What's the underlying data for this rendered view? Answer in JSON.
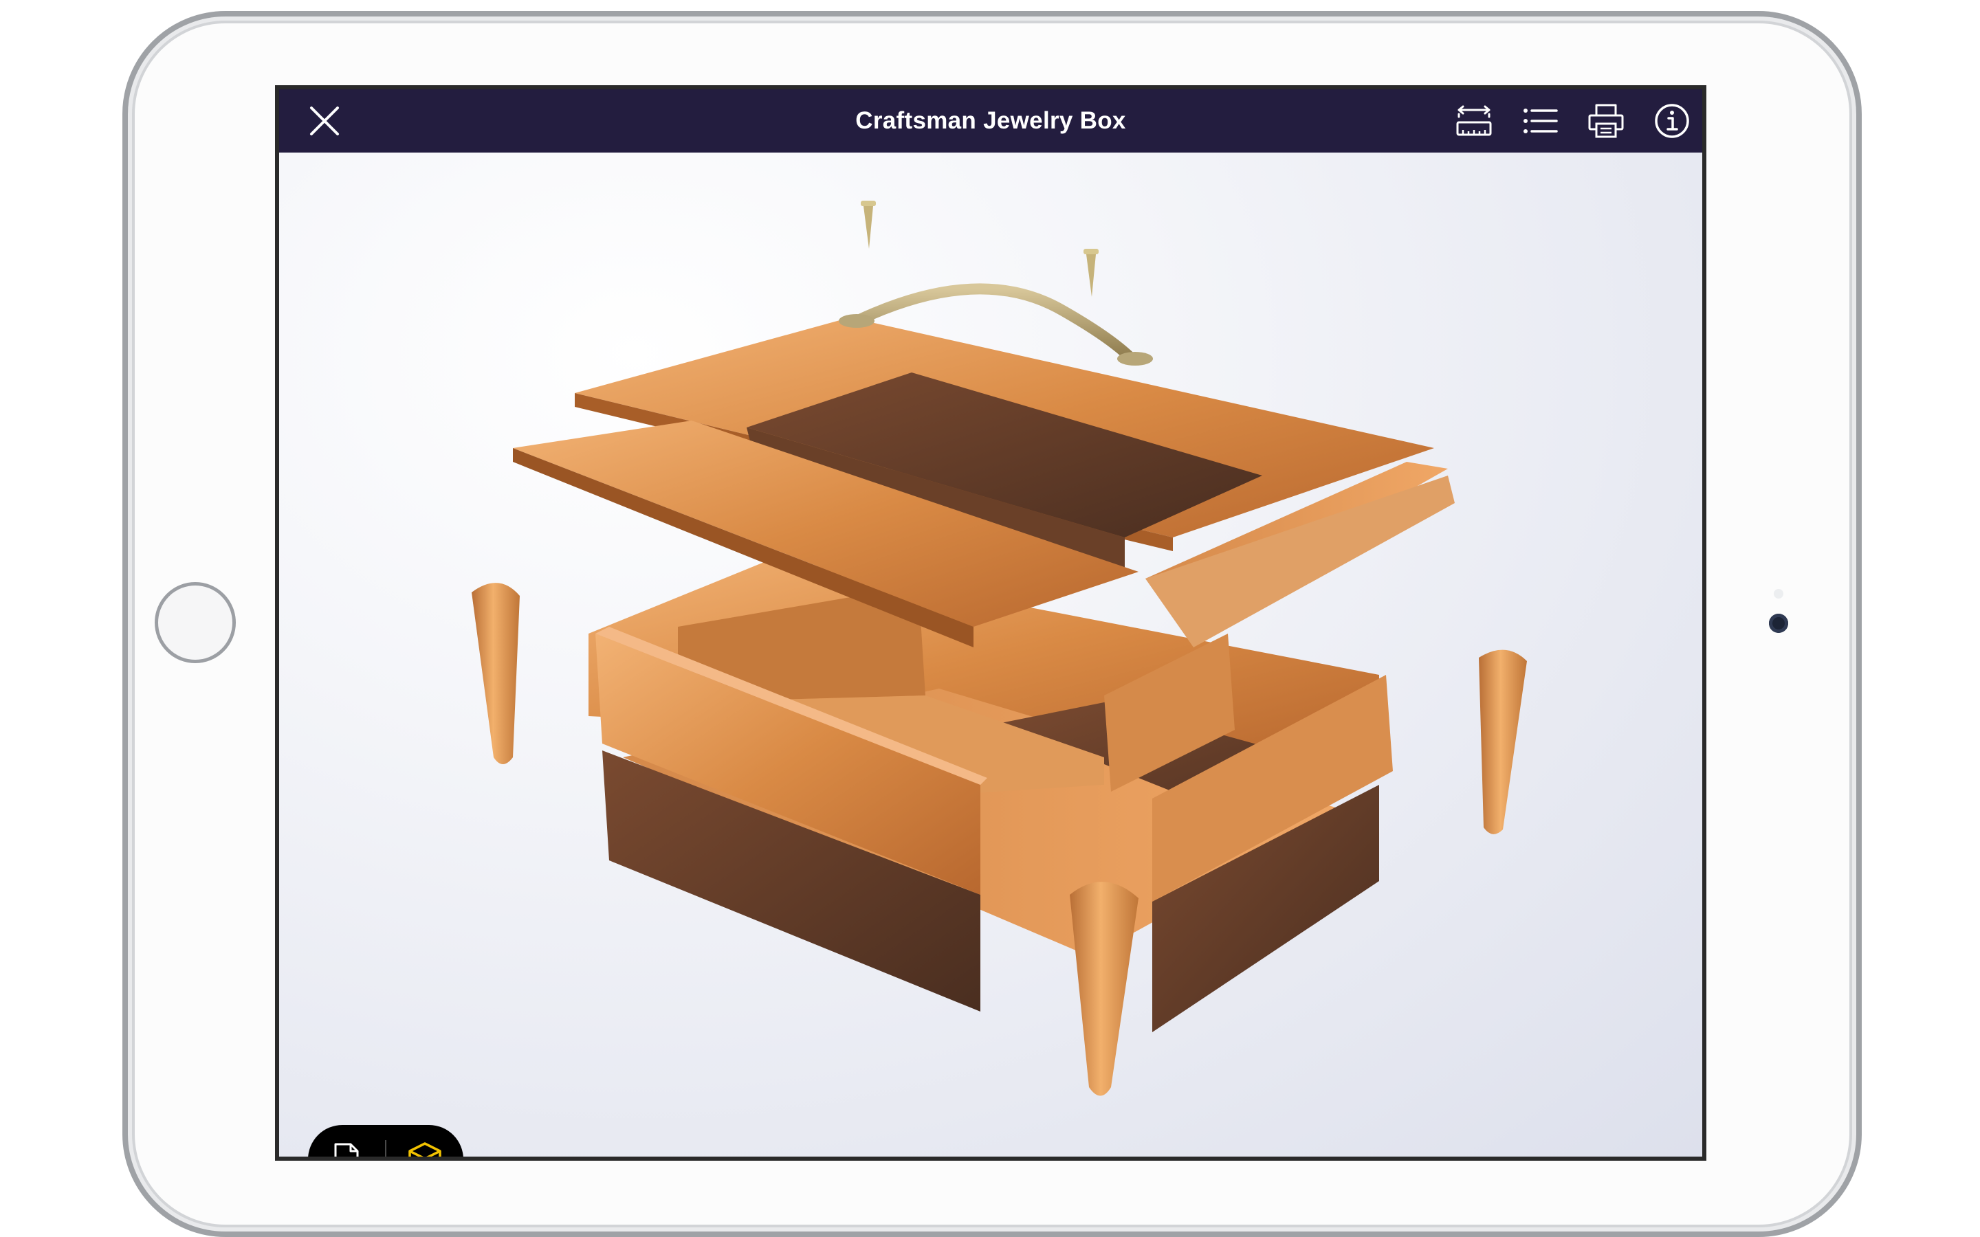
{
  "header": {
    "title": "Craftsman Jewelry Box",
    "close_icon": "close-icon",
    "actions": [
      {
        "name": "dimensions-ruler",
        "icon": "ruler-dimensions-icon"
      },
      {
        "name": "cut-list",
        "icon": "list-icon"
      },
      {
        "name": "print",
        "icon": "printer-icon"
      },
      {
        "name": "info",
        "icon": "info-icon"
      }
    ]
  },
  "view_mode": {
    "options": [
      {
        "name": "document",
        "icon": "document-icon",
        "active": false
      },
      {
        "name": "3d-model",
        "icon": "cube-icon",
        "active": true
      }
    ],
    "active_color": "#f2c200",
    "inactive_color": "#ffffff"
  },
  "colors": {
    "nav_background": "#231d3f",
    "wood_light": "#d98a45",
    "wood_dark": "#5a3a28"
  }
}
